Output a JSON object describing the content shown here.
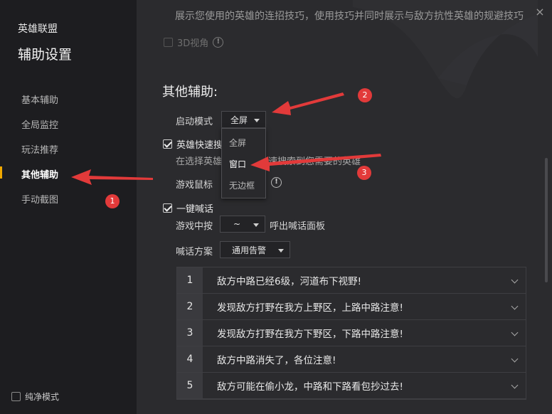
{
  "window": {
    "close_label": "×"
  },
  "sidebar": {
    "app_name": "英雄联盟",
    "heading": "辅助设置",
    "items": [
      {
        "label": "基本辅助"
      },
      {
        "label": "全局监控"
      },
      {
        "label": "玩法推荐"
      },
      {
        "label": "其他辅助",
        "active": true
      },
      {
        "label": "手动截图"
      }
    ],
    "pure_mode_label": "纯净模式",
    "accent_color": "#f0a800"
  },
  "main": {
    "top_cut_text": "展示您使用的英雄的连招技巧，使用技巧并同时展示与敌方抗性英雄的规避技巧",
    "view3d_label": "3D视角",
    "section_title": "其他辅助:",
    "launch_mode": {
      "label": "启动模式",
      "selected": "全屏",
      "options": [
        "全屏",
        "窗口",
        "无边框"
      ],
      "highlighted": "窗口"
    },
    "hero_search": {
      "label": "英雄快速搜",
      "desc_left": "在选择英雄",
      "desc_right": "速搜索到您需要的英雄"
    },
    "game_cursor_label": "游戏鼠标",
    "one_key_shout": {
      "label": "一键喊话",
      "key_label": "游戏中按",
      "key_value": "~",
      "key_suffix": "呼出喊话面板",
      "plan_label": "喊话方案",
      "plan_value": "通用告警"
    },
    "messages": [
      {
        "num": "1",
        "text": "敌方中路已经6级，河道布下视野!"
      },
      {
        "num": "2",
        "text": "发现敌方打野在我方上野区，上路中路注意!"
      },
      {
        "num": "3",
        "text": "发现敌方打野在我方下野区，下路中路注意!"
      },
      {
        "num": "4",
        "text": "敌方中路消失了，各位注意!"
      },
      {
        "num": "5",
        "text": "敌方可能在偷小龙，中路和下路看包抄过去!"
      }
    ]
  },
  "annotations": {
    "badges": [
      "1",
      "2",
      "3"
    ],
    "color": "#e23a3a"
  }
}
